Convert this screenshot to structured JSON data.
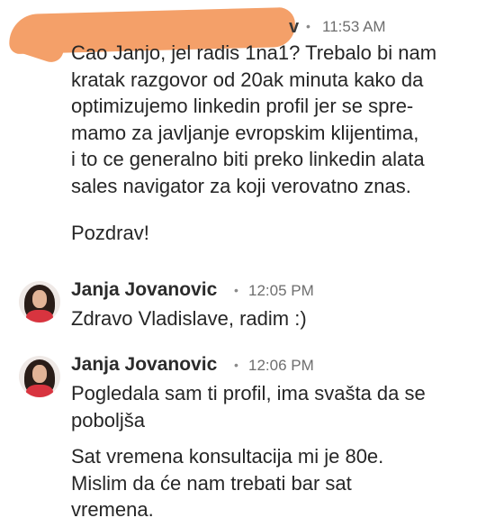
{
  "messages": [
    {
      "sender_visible": "v",
      "separator": "•",
      "time": "11:53 AM",
      "body": "Cao Janjo, jel radis 1na1? Trebalo bi nam\nkratak razgovor od 20ak minuta kako da\noptimizujemo linkedin profil jer se spre-\nmamo za javljanje evropskim klijentima,\ni to ce generalno biti preko linkedin alata\nsales navigator za koji verovatno znas.",
      "signoff": "Pozdrav!"
    },
    {
      "sender": "Janja Jovanovic",
      "separator": "•",
      "time": "12:05 PM",
      "body": "Zdravo Vladislave, radim :)"
    },
    {
      "sender": "Janja Jovanovic",
      "separator": "•",
      "time": "12:06 PM",
      "body": "Pogledala sam ti profil, ima svašta da se\npoboljša",
      "body2": "Sat vremena konsultacija mi je 80e.\nMislim da će nam trebati bar sat\nvremena."
    }
  ],
  "colors": {
    "redaction": "#f4a069",
    "text": "#262626",
    "meta": "#6e6e6e"
  }
}
